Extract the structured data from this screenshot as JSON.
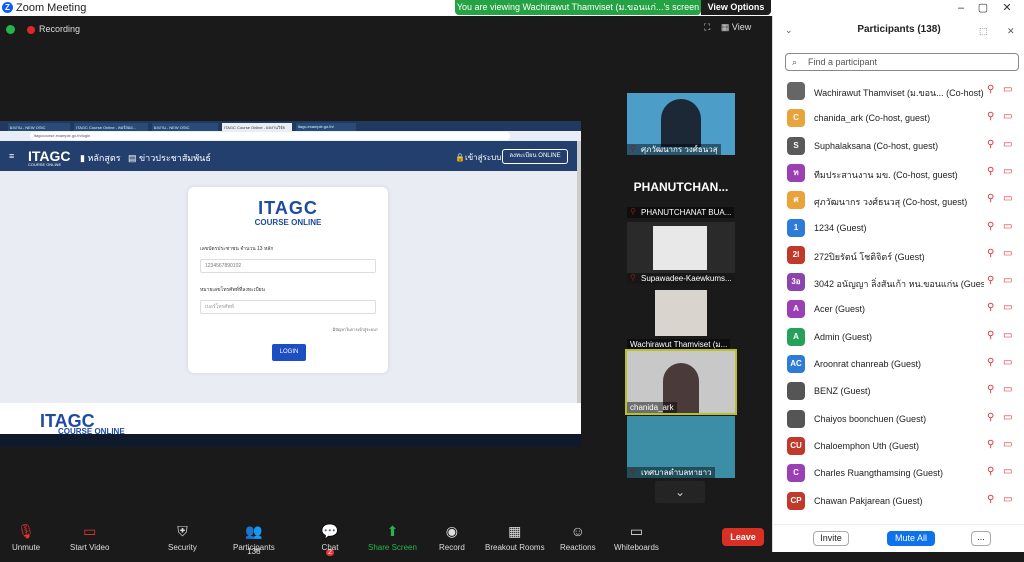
{
  "window": {
    "title": "Zoom Meeting",
    "view_banner": "You are viewing Wachirawut Thamviset (ม.ขอนแก่...'s screen",
    "view_options": "View Options"
  },
  "status": {
    "recording": "Recording",
    "view_label": "View"
  },
  "shared_screen": {
    "tabs": [
      "ผลงาน - NEW OSIC",
      "ITAGC Course Online - คอร์สออ...",
      "ผลงาน - NEW OSIC",
      "ITAGC Course Online - ผลงานวิจัย",
      "itagc.example.go.th/"
    ],
    "url": "itagccourse.example.go.th/login",
    "site_logo": "ITAGC",
    "site_logo_sub": "COURSE ONLINE",
    "nav": [
      "หลักสูตร",
      "ข่าวประชาสัมพันธ์"
    ],
    "login_link": "เข้าสู่ระบบ",
    "register_button": "ลงทะเบียน ONLINE",
    "card": {
      "logo": "ITAGC",
      "logo_sub": "COURSE ONLINE",
      "id_label": "เลขบัตรประชาชน จำนวน 13 หลัก",
      "id_value": "1234567890102",
      "phone_label": "หมายเลขโทรศัพท์ที่ลงทะเบียน",
      "phone_placeholder": "เบอร์โทรศัพท์",
      "forgot": "มีปัญหาในการเข้าสู่ระบบ?",
      "login_button": "LOGIN"
    },
    "bottom_logo": "ITAGC",
    "bottom_logo_sub": "COURSE ONLINE"
  },
  "thumbnails": [
    {
      "name": "ศุภวัฒนากร วงศ์ธนวสุ"
    },
    {
      "name": "PHANUTCHANAT BUA...",
      "big": "PHANUTCHAN..."
    },
    {
      "name": "Supawadee-Kaewkums..."
    },
    {
      "name": "Wachirawut Thamviset (ม..."
    },
    {
      "name": "chanida_ark"
    },
    {
      "name": "เทศบาลตำบลทายาว"
    }
  ],
  "toolbar": {
    "unmute": "Unmute",
    "start_video": "Start Video",
    "security": "Security",
    "participants": "Participants",
    "participants_count": "138",
    "chat": "Chat",
    "chat_badge": "2",
    "share_screen": "Share Screen",
    "record": "Record",
    "breakout": "Breakout Rooms",
    "reactions": "Reactions",
    "whiteboards": "Whiteboards",
    "leave": "Leave"
  },
  "panel": {
    "title": "Participants (138)",
    "search_placeholder": "Find a participant",
    "invite": "Invite",
    "mute_all": "Mute All",
    "more": "...",
    "participants": [
      {
        "name": "Wachirawut Thamviset (ม.ขอน... (Co-host)",
        "avatar": "",
        "color": "#666666"
      },
      {
        "name": "chanida_ark (Co-host, guest)",
        "avatar": "C",
        "color": "#e8a33a"
      },
      {
        "name": "Suphalaksana (Co-host, guest)",
        "avatar": "S",
        "color": "#5a5a5a"
      },
      {
        "name": "ทีมประสานงาน มข. (Co-host, guest)",
        "avatar": "ท",
        "color": "#9b3fb5"
      },
      {
        "name": "ศุภวัฒนากร วงศ์ธนวสุ (Co-host, guest)",
        "avatar": "ศ",
        "color": "#e8a33a"
      },
      {
        "name": "1234 (Guest)",
        "avatar": "1",
        "color": "#2f7bd8"
      },
      {
        "name": "272ปิยรัตน์ โชติจิตร์ (Guest)",
        "avatar": "2l",
        "color": "#c0392b"
      },
      {
        "name": "3042 อนัญญา ลิ่งสันเก้า หน.ขอนแก่น (Guest)",
        "avatar": "3อ",
        "color": "#8e44ad"
      },
      {
        "name": "Acer (Guest)",
        "avatar": "A",
        "color": "#9b3fb5"
      },
      {
        "name": "Admin (Guest)",
        "avatar": "A",
        "color": "#27a05a"
      },
      {
        "name": "Aroonrat chanreab (Guest)",
        "avatar": "AC",
        "color": "#2f7bd8"
      },
      {
        "name": "BENZ (Guest)",
        "avatar": "",
        "color": "#555555"
      },
      {
        "name": "Chaiyos boonchuen (Guest)",
        "avatar": "",
        "color": "#555555"
      },
      {
        "name": "Chaloemphon Uth (Guest)",
        "avatar": "CU",
        "color": "#c0392b"
      },
      {
        "name": "Charles Ruangthamsing (Guest)",
        "avatar": "C",
        "color": "#9b3fb5"
      },
      {
        "name": "Chawan Pakjarean (Guest)",
        "avatar": "CP",
        "color": "#c0392b"
      }
    ]
  }
}
